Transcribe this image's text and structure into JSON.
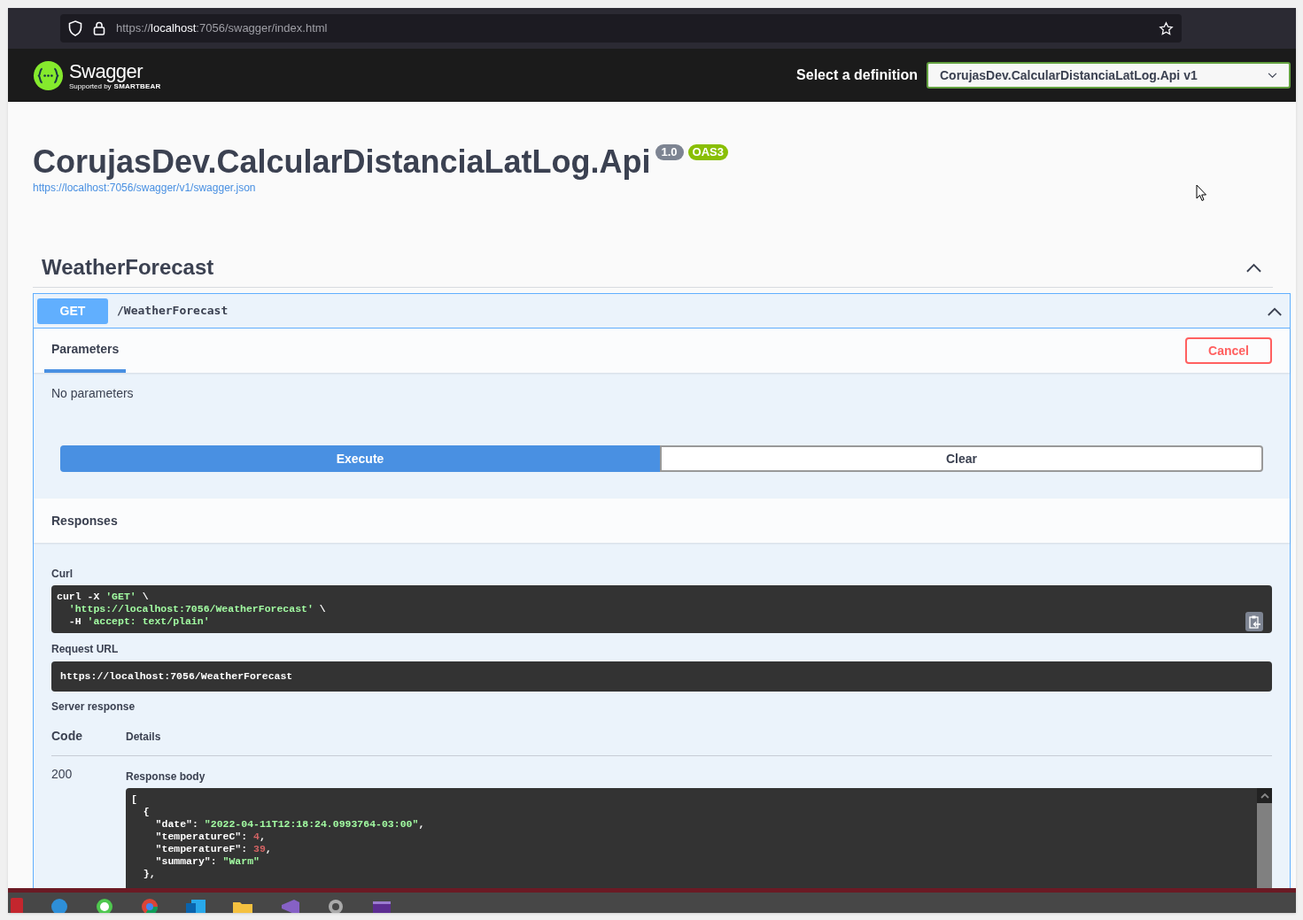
{
  "browser": {
    "url": [
      {
        "text": "https://",
        "kind": "dim"
      },
      {
        "text": "localhost",
        "kind": "host"
      },
      {
        "text": ":7056/swagger/index.html",
        "kind": "dim"
      }
    ]
  },
  "header": {
    "logo_text": "Swagger",
    "logo_subtext": "Supported by",
    "logo_brand": "SMARTBEAR",
    "definition_label": "Select a definition",
    "definition_value": "CorujasDev.CalcularDistanciaLatLog.Api v1"
  },
  "info": {
    "title": "CorujasDev.CalcularDistanciaLatLog.Api",
    "version": "1.0",
    "oas": "OAS3",
    "spec_url": "https://localhost:7056/swagger/v1/swagger.json"
  },
  "tag": {
    "name": "WeatherForecast",
    "expanded": true
  },
  "operation": {
    "method": "GET",
    "path": "/WeatherForecast",
    "expanded": true,
    "tabs": [
      {
        "label": "Parameters",
        "selected": true
      }
    ],
    "cancel": "Cancel",
    "no_params": "No parameters",
    "execute": "Execute",
    "clear": "Clear",
    "responses_title": "Responses",
    "curl_label": "Curl",
    "curl": [
      [
        {
          "text": "curl -X ",
          "kind": "plain"
        },
        {
          "text": "'GET'",
          "kind": "string"
        },
        {
          "text": " \\",
          "kind": "plain"
        }
      ],
      [
        {
          "text": "  'https://localhost:7056/WeatherForecast'",
          "kind": "string"
        },
        {
          "text": " \\",
          "kind": "plain"
        }
      ],
      [
        {
          "text": "  -H ",
          "kind": "plain"
        },
        {
          "text": "'accept: text/plain'",
          "kind": "string"
        }
      ]
    ],
    "request_url_label": "Request URL",
    "request_url": "https://localhost:7056/WeatherForecast",
    "server_response_label": "Server response",
    "columns": [
      "Code",
      "Details"
    ],
    "response": {
      "code": "200",
      "body_label": "Response body",
      "body": [
        [
          {
            "text": "[",
            "kind": "plain"
          }
        ],
        [
          {
            "text": "  {",
            "kind": "plain"
          }
        ],
        [
          {
            "text": "    \"date\": ",
            "kind": "plain"
          },
          {
            "text": "\"2022-04-11T12:18:24.0993764-03:00\"",
            "kind": "string"
          },
          {
            "text": ",",
            "kind": "plain"
          }
        ],
        [
          {
            "text": "    \"temperatureC\": ",
            "kind": "plain"
          },
          {
            "text": "4",
            "kind": "number"
          },
          {
            "text": ",",
            "kind": "plain"
          }
        ],
        [
          {
            "text": "    \"temperatureF\": ",
            "kind": "plain"
          },
          {
            "text": "39",
            "kind": "number"
          },
          {
            "text": ",",
            "kind": "plain"
          }
        ],
        [
          {
            "text": "    \"summary\": ",
            "kind": "plain"
          },
          {
            "text": "\"Warm\"",
            "kind": "string"
          }
        ],
        [
          {
            "text": "  },",
            "kind": "plain"
          }
        ]
      ]
    }
  }
}
